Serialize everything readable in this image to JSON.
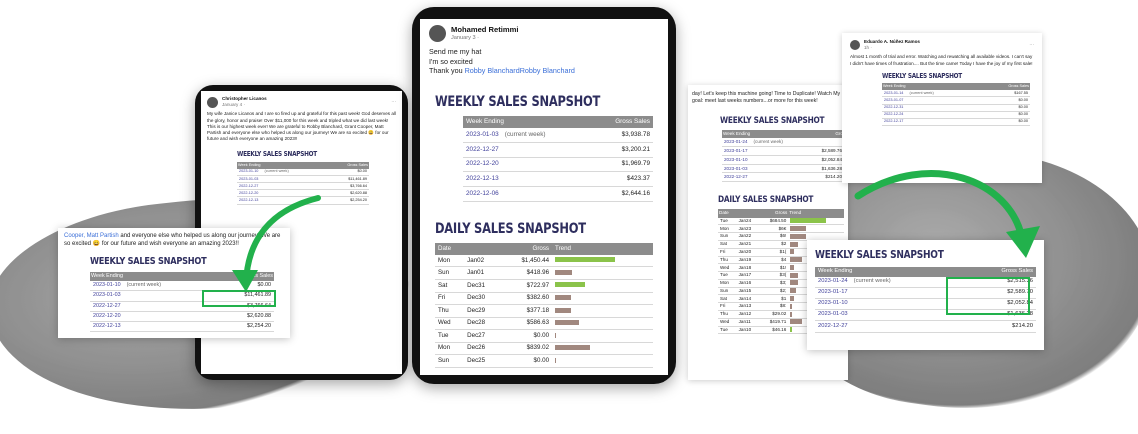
{
  "left_tablet": {
    "author": "Christopher Licanos",
    "date": "January 4 ·",
    "post_text": "My wife Janice Licanos and I are so fired up and grateful for this past week! God deserves all the glory, honor and praise! Over $11,000 for this week and tripled what we did last week! This is our highest week ever! We are grateful to Robby Blanchard, Grant Cooper, Matt Partish and everyone else who helped us along our journey! We are so excited 😄 for our future and wish everyone an amazing 2023!!",
    "table_title": "WEEKLY SALES SNAPSHOT",
    "col_week": "Week Ending",
    "col_sales": "Gross Sales",
    "rows": [
      {
        "week": "2023-01-10",
        "note": "(current week)",
        "sales": "$0.00"
      },
      {
        "week": "2023-01-03",
        "note": "",
        "sales": "$11,461.89"
      },
      {
        "week": "2022-12-27",
        "note": "",
        "sales": "$3,766.64"
      },
      {
        "week": "2022-12-20",
        "note": "",
        "sales": "$2,620.88"
      },
      {
        "week": "2022-12-13",
        "note": "",
        "sales": "$2,254.20"
      }
    ]
  },
  "left_card": {
    "text_a": "Cooper, Matt Partish",
    "text_b": " and everyone else who helped us along our journey! We are so excited 😄 for our future and wish everyone an amazing 2023!!",
    "table_title": "WEEKLY SALES SNAPSHOT",
    "col_week": "Week Ending",
    "col_sales": "Gross Sales",
    "rows": [
      {
        "week": "2023-01-10",
        "note": "(current week)",
        "sales": "$0.00"
      },
      {
        "week": "2023-01-03",
        "note": "",
        "sales": "$11,461.89"
      },
      {
        "week": "2022-12-27",
        "note": "",
        "sales": "$3,766.64"
      },
      {
        "week": "2022-12-20",
        "note": "",
        "sales": "$2,620.88"
      },
      {
        "week": "2022-12-13",
        "note": "",
        "sales": "$2,254.20"
      }
    ]
  },
  "center_tablet": {
    "author": "Mohamed Retimmi",
    "date": "January 3 ·",
    "line1": "Send me my hat",
    "line2": "I'm so excited",
    "line3_prefix": "Thank you ",
    "line3_link": "Robby BlanchardRobby Blanchard",
    "weekly_title": "WEEKLY SALES SNAPSHOT",
    "col_week": "Week Ending",
    "col_sales": "Gross Sales",
    "weekly_rows": [
      {
        "week": "2023-01-03",
        "note": "(current week)",
        "sales": "$3,938.78"
      },
      {
        "week": "2022-12-27",
        "note": "",
        "sales": "$3,200.21"
      },
      {
        "week": "2022-12-20",
        "note": "",
        "sales": "$1,969.79"
      },
      {
        "week": "2022-12-13",
        "note": "",
        "sales": "$423.37"
      },
      {
        "week": "2022-12-06",
        "note": "",
        "sales": "$2,644.16"
      }
    ],
    "daily_title": "DAILY SALES SNAPSHOT",
    "col_date": "Date",
    "col_gross": "Gross",
    "col_trend": "Trend",
    "daily_rows": [
      {
        "dow": "Mon",
        "date": "Jan02",
        "gross": "$1,450.44",
        "trend": 1.0,
        "color": "#8bc34a"
      },
      {
        "dow": "Sun",
        "date": "Jan01",
        "gross": "$418.96",
        "trend": 0.29,
        "color": "#a1887f"
      },
      {
        "dow": "Sat",
        "date": "Dec31",
        "gross": "$722.97",
        "trend": 0.5,
        "color": "#8bc34a"
      },
      {
        "dow": "Fri",
        "date": "Dec30",
        "gross": "$382.60",
        "trend": 0.26,
        "color": "#a1887f"
      },
      {
        "dow": "Thu",
        "date": "Dec29",
        "gross": "$377.18",
        "trend": 0.26,
        "color": "#a1887f"
      },
      {
        "dow": "Wed",
        "date": "Dec28",
        "gross": "$586.63",
        "trend": 0.4,
        "color": "#a1887f"
      },
      {
        "dow": "Tue",
        "date": "Dec27",
        "gross": "$0.00",
        "trend": 0.01,
        "color": "#a1887f"
      },
      {
        "dow": "Mon",
        "date": "Dec26",
        "gross": "$839.02",
        "trend": 0.58,
        "color": "#a1887f"
      },
      {
        "dow": "Sun",
        "date": "Dec25",
        "gross": "$0.00",
        "trend": 0.01,
        "color": "#a1887f"
      }
    ]
  },
  "right_paper": {
    "text": "day! Let's keep this machine going! Time to Duplicate! Watch My goal: meet last weeks numbers...or more for this week!",
    "weekly_title": "WEEKLY SALES SNAPSHOT",
    "col_week": "Week Ending",
    "col_sales": "Gro",
    "weekly_rows": [
      {
        "week": "2023-01-24",
        "note": "(current week)",
        "sales": ""
      },
      {
        "week": "2023-01-17",
        "note": "",
        "sales": "$2,589.76"
      },
      {
        "week": "2023-01-10",
        "note": "",
        "sales": "$2,052.84"
      },
      {
        "week": "2023-01-03",
        "note": "",
        "sales": "$1,636.28"
      },
      {
        "week": "2022-12-27",
        "note": "",
        "sales": "$214.20"
      }
    ],
    "daily_title": "DAILY SALES SNAPSHOT",
    "col_date": "Date",
    "col_gross": "Gross",
    "col_trend": "Trend",
    "daily_rows": [
      {
        "dow": "Tue",
        "date": "Jan24",
        "gross": "$684.50",
        "trend": 0.9,
        "color": "#8bc34a"
      },
      {
        "dow": "Mon",
        "date": "Jan23",
        "gross": "$6€",
        "trend": 0.4,
        "color": "#a1887f"
      },
      {
        "dow": "Sun",
        "date": "Jan22",
        "gross": "$6!",
        "trend": 0.4,
        "color": "#a1887f"
      },
      {
        "dow": "Sat",
        "date": "Jan21",
        "gross": "$2",
        "trend": 0.2,
        "color": "#a1887f"
      },
      {
        "dow": "Fri",
        "date": "Jan20",
        "gross": "$1(",
        "trend": 0.1,
        "color": "#a1887f"
      },
      {
        "dow": "Thu",
        "date": "Jan19",
        "gross": "$4",
        "trend": 0.3,
        "color": "#a1887f"
      },
      {
        "dow": "Wed",
        "date": "Jan18",
        "gross": "$1!",
        "trend": 0.1,
        "color": "#a1887f"
      },
      {
        "dow": "Tue",
        "date": "Jan17",
        "gross": "$3(",
        "trend": 0.2,
        "color": "#a1887f"
      },
      {
        "dow": "Mon",
        "date": "Jan16",
        "gross": "$3;",
        "trend": 0.2,
        "color": "#a1887f"
      },
      {
        "dow": "Sun",
        "date": "Jan15",
        "gross": "$2;",
        "trend": 0.15,
        "color": "#a1887f"
      },
      {
        "dow": "Sat",
        "date": "Jan14",
        "gross": "$1",
        "trend": 0.1,
        "color": "#a1887f"
      },
      {
        "dow": "Fri",
        "date": "Jan13",
        "gross": "$8:",
        "trend": 0.05,
        "color": "#a1887f"
      },
      {
        "dow": "Thu",
        "date": "Jan12",
        "gross": "$29.02",
        "trend": 0.05,
        "color": "#a1887f"
      },
      {
        "dow": "Wed",
        "date": "Jan11",
        "gross": "$419.71",
        "trend": 0.3,
        "color": "#a1887f"
      },
      {
        "dow": "Tue",
        "date": "Jan10",
        "gross": "$46.16",
        "trend": 0.05,
        "color": "#8bc34a"
      }
    ]
  },
  "right_post": {
    "author": "Eduardo A. Núñez Ramos",
    "date": "1h ·",
    "text": "Almost 1 month of trial and error. Watching and rewatching all available videos. I can't say I didn't have times of frustration.... But the time came! Today I have the joy of my first sale!",
    "weekly_title": "WEEKLY SALES SNAPSHOT",
    "col_week": "Week Ending",
    "col_sales": "Gross Sales",
    "weekly_rows": [
      {
        "week": "2023-01-14",
        "note": "(current week)",
        "sales": "$167.55"
      },
      {
        "week": "2023-01-07",
        "note": "",
        "sales": "$0.00"
      },
      {
        "week": "2022-12-31",
        "note": "",
        "sales": "$0.00"
      },
      {
        "week": "2022-12-24",
        "note": "",
        "sales": "$0.00"
      },
      {
        "week": "2022-12-17",
        "note": "",
        "sales": "$0.00"
      }
    ]
  },
  "right_card": {
    "table_title": "WEEKLY SALES SNAPSHOT",
    "col_week": "Week Ending",
    "col_sales": "Gross Sales",
    "rows": [
      {
        "week": "2023-01-24",
        "note": "(current week)",
        "sales": "$2,515.36"
      },
      {
        "week": "2023-01-17",
        "note": "",
        "sales": "$2,589.70"
      },
      {
        "week": "2023-01-10",
        "note": "",
        "sales": "$2,052.84"
      },
      {
        "week": "2023-01-03",
        "note": "",
        "sales": "$1,636.28"
      },
      {
        "week": "2022-12-27",
        "note": "",
        "sales": "$214.20"
      }
    ]
  },
  "colors": {
    "highlight": "#22b14c",
    "arrow": "#22b14c",
    "header": "#8c8c8c",
    "title": "#2e2e5e"
  }
}
